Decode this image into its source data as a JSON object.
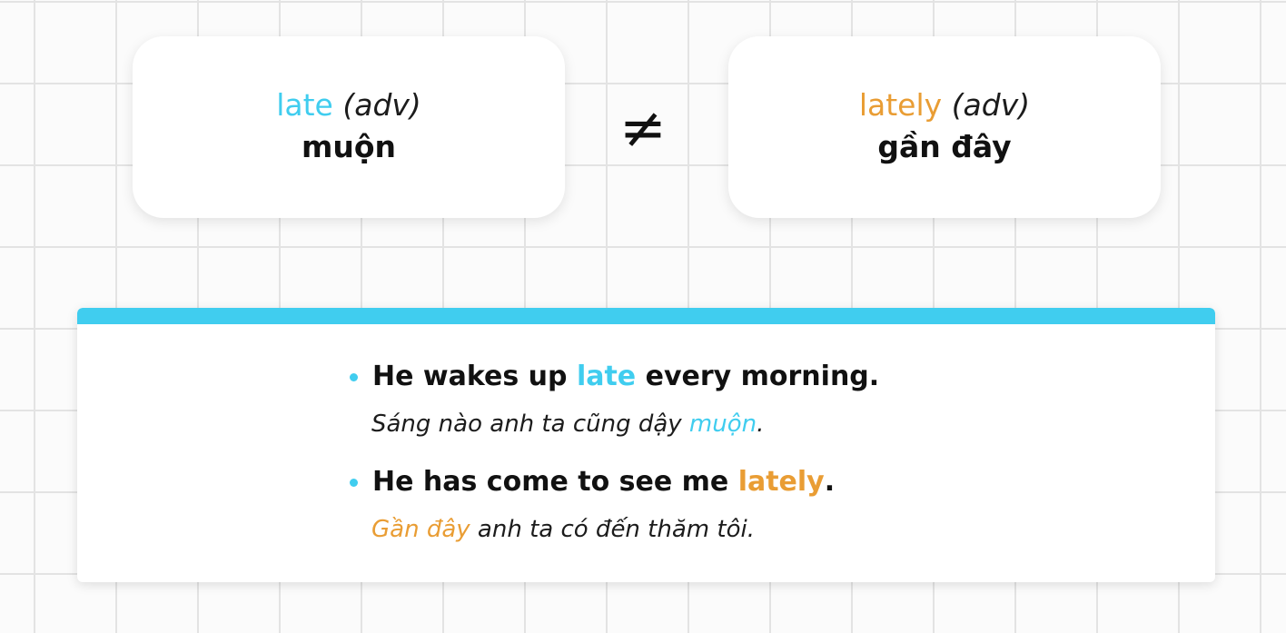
{
  "colors": {
    "late_accent": "#40cdef",
    "lately_accent": "#e99d34",
    "panel_topbar": "#40cdef",
    "bullet": "#40cdef"
  },
  "left_card": {
    "word": "late",
    "pos": "(adv)",
    "meaning": "muộn"
  },
  "comparison_symbol": "≠",
  "right_card": {
    "word": "lately",
    "pos": "(adv)",
    "meaning": "gần đây"
  },
  "examples": [
    {
      "sentence_before": "He wakes up ",
      "sentence_highlight": "late",
      "sentence_after": " every morning.",
      "translation_before": "Sáng nào anh ta cũng dậy ",
      "translation_highlight": "muộn",
      "translation_after": "."
    },
    {
      "sentence_before": "He has come to see me ",
      "sentence_highlight": "lately",
      "sentence_after": ".",
      "translation_before": "",
      "translation_highlight": "Gần đây",
      "translation_after": " anh ta có đến thăm tôi."
    }
  ]
}
